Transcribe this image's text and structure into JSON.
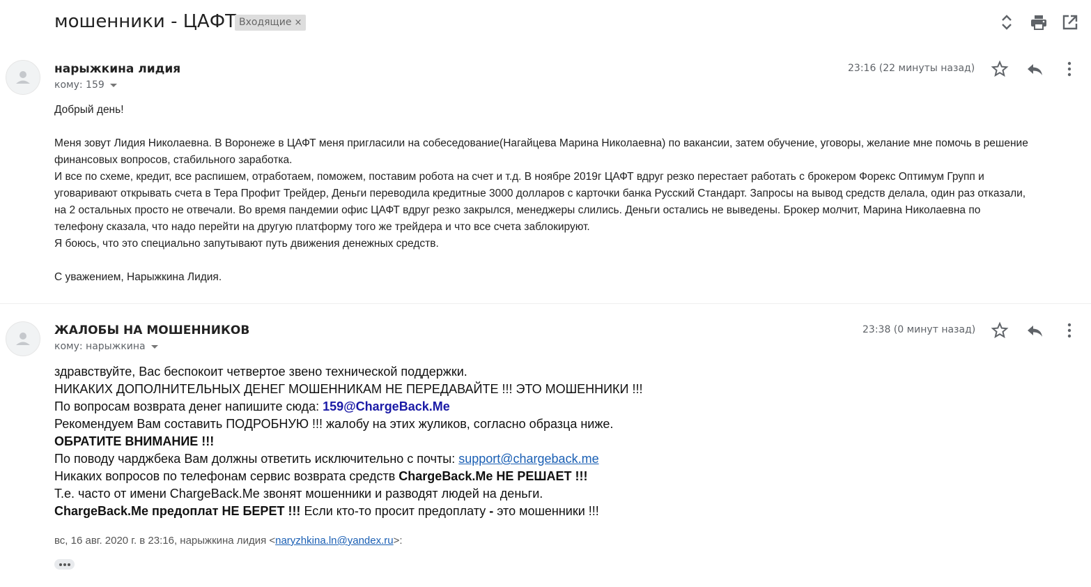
{
  "thread": {
    "subject": "мошенники - ЦАФТ",
    "label": "Входящие",
    "label_close": "×"
  },
  "icons": {
    "expand": "unfold-icon",
    "print": "print-icon",
    "new_window": "open-in-new-icon",
    "star": "star-icon",
    "reply": "reply-icon",
    "more": "more-vert-icon"
  },
  "messages": [
    {
      "sender": "нарыжкина лидия",
      "to": "кому: 159",
      "time": "23:16 (22 минуты назад)",
      "body": {
        "greeting": "Добрый день!",
        "p1_line1": "Меня зовут Лидия Николаевна. В Воронеже в ЦАФТ меня пригласили на собеседование(Нагайцева Марина Николаевна) по вакансии, затем обучение, уговоры, желание мне помочь в решение",
        "p1_line2": "финансовых вопросов, стабильного заработка.",
        "p2_line1": "И все по схеме, кредит, все распишем, отработаем, поможем, поставим робота на счет и т.д. В ноябре 2019г ЦАФТ вдруг резко перестает работать с брокером Форекс Оптимум Групп и",
        "p2_line2": "уговаривают открывать счета в Тера Профит Трейдер, Деньги переводила кредитные 3000 долларов с карточки банка Русский Стандарт. Запросы на вывод средств делала, один раз отказали,",
        "p2_line3": "на 2 остальных просто не отвечали. Во время пандемии офис ЦАФТ вдруг резко закрылся, менеджеры слились. Деньги остались не выведены. Брокер молчит, Марина Николаевна по",
        "p2_line4": "телефону сказала, что надо перейти на другую платформу того же трейдера и что все счета заблокируют.",
        "p3": "Я боюсь, что это специально запутывают путь движения денежных средств.",
        "signature": "С уважением, Нарыжкина Лидия."
      }
    },
    {
      "sender": "ЖАЛОБЫ НА МОШЕННИКОВ",
      "to": "кому: нарыжкина",
      "time": "23:38 (0 минут назад)",
      "body": {
        "l1": "здравствуйте, Вас беспокоит четвертое звено технической поддержки.",
        "l2": "НИКАКИХ ДОПОЛНИТЕЛЬНЫХ ДЕНЕГ МОШЕННИКАМ НЕ ПЕРЕДАВАЙТЕ !!! ЭТО МОШЕННИКИ !!!",
        "l3_prefix": "По вопросам возврата денег напишите сюда: ",
        "l3_email": "159@ChargeBack.Me",
        "l4": "Рекомендуем Вам составить ПОДРОБНУЮ !!! жалобу на этих жуликов, согласно образца ниже.",
        "l5": "ОБРАТИТЕ ВНИМАНИЕ !!!",
        "l6_prefix": "По поводу чарджбека Вам должны ответить исключительно с почты: ",
        "l6_link": "support@chargeback.me",
        "l7_prefix": "Никаких вопросов по телефонам сервис возврата средств ",
        "l7_bold": "ChargeBack.Me НЕ РЕШАЕТ !!!",
        "l8": "Т.е. часто от имени ChargeBack.Me звонят мошенники и разводят людей на деньги.",
        "l9_bold": "ChargeBack.Me предоплат НЕ БЕРЕТ !!!",
        "l9_mid": " Если кто-то просит предоплату ",
        "l9_dash": "-",
        "l9_end": " это мошенники !!!"
      },
      "quote": {
        "prefix": "вс, 16 авг. 2020 г. в 23:16, нарыжкина лидия <",
        "email": "naryzhkina.ln@yandex.ru",
        "suffix": ">:"
      }
    }
  ]
}
